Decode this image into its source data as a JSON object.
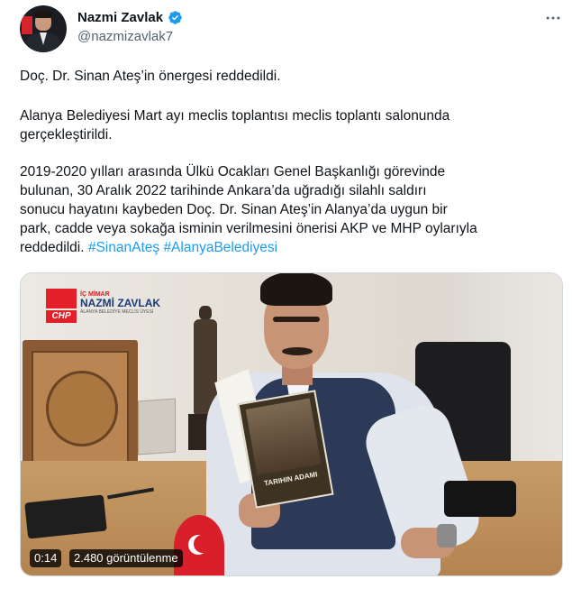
{
  "author": {
    "display_name": "Nazmi Zavlak",
    "handle": "@nazmizavlak7",
    "verified": true
  },
  "tweet": {
    "paragraph1": "Doç. Dr. Sinan Ateş’in önergesi reddedildi.",
    "paragraph2_line1": "Alanya Belediyesi Mart ayı meclis toplantısı meclis toplantı salonunda",
    "paragraph2_line2": "gerçekleştirildi.",
    "paragraph3_line1": "2019-2020 yılları arasında Ülkü Ocakları Genel Başkanlığı görevinde",
    "paragraph3_line2": "bulunan, 30 Aralık 2022 tarihinde Ankara’da uğradığı silahlı saldırı",
    "paragraph3_line3": "sonucu hayatını kaybeden Doç. Dr. Sinan Ateş’in Alanya’da uygun bir",
    "paragraph3_line4": "park, cadde veya sokağa isminin verilmesini önerisi AKP ve MHP oylarıyla",
    "paragraph3_line5_text": "reddedildi.",
    "hashtags": [
      "#SinanAteş",
      "#AlanyaBelediyesi"
    ]
  },
  "media": {
    "type": "video",
    "duration": "0:14",
    "views": "2.480 görüntülenme",
    "watermark": {
      "logo_text": "CHP",
      "line1": "İÇ MİMAR",
      "line2": "NAZMİ ZAVLAK",
      "line3": "ALANYA BELEDİYE MECLİS ÜYESİ"
    },
    "book_title": "TARIHIN ADAMI"
  },
  "colors": {
    "text": "#0f1419",
    "secondary": "#536471",
    "link": "#1d9bf0",
    "verified": "#1d9bf0"
  },
  "icons": {
    "verified": "verified-badge-icon",
    "more": "more-options-icon"
  }
}
